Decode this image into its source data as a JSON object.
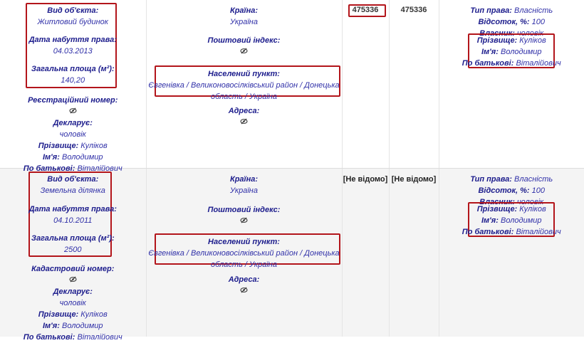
{
  "rows": [
    {
      "object": {
        "type_label": "Вид об'єкта:",
        "type_value": "Житловий будинок",
        "date_label": "Дата набуття права:",
        "date_value": "04.03.2013",
        "area_label": "Загальна площа (м²):",
        "area_value": "140,20",
        "id_label": "Реєстраційний номер:",
        "declarant_label": "Декларує:",
        "declarant_value": "чоловік",
        "surname_label": "Прізвище:",
        "surname_value": "Куліков",
        "name_label": "Ім'я:",
        "name_value": "Володимир",
        "patronymic_label": "По батькові:",
        "patronymic_value": "Віталійович"
      },
      "location": {
        "country_label": "Країна:",
        "country_value": "Україна",
        "postal_label": "Поштовий індекс:",
        "settlement_label": "Населений пункт:",
        "settlement_value_1": "Євгенівка / Великоновосілківський район / Донецька",
        "settlement_value_2": "область / Україна",
        "address_label": "Адреса:"
      },
      "cost": "475336",
      "cost2": "475336",
      "rights": {
        "type_label": "Тип права:",
        "type_value": "Власність",
        "share_label": "Відсоток, %:",
        "share_value": "100",
        "owner_label": "Власник:",
        "owner_value": "чоловік",
        "surname_label": "Прізвище:",
        "surname_value": "Куліков",
        "name_label": "Ім'я:",
        "name_value": "Володимир",
        "patronymic_label": "По батькові:",
        "patronymic_value": "Віталійович"
      }
    },
    {
      "object": {
        "type_label": "Вид об'єкта:",
        "type_value": "Земельна ділянка",
        "date_label": "Дата набуття права:",
        "date_value": "04.10.2011",
        "area_label": "Загальна площа (м²):",
        "area_value": "2500",
        "id_label": "Кадастровий номер:",
        "declarant_label": "Декларує:",
        "declarant_value": "чоловік",
        "surname_label": "Прізвище:",
        "surname_value": "Куліков",
        "name_label": "Ім'я:",
        "name_value": "Володимир",
        "patronymic_label": "По батькові:",
        "patronymic_value": "Віталійович"
      },
      "location": {
        "country_label": "Країна:",
        "country_value": "Україна",
        "postal_label": "Поштовий індекс:",
        "settlement_label": "Населений пункт:",
        "settlement_value_1": "Євгенівка / Великоновосілківський район / Донецька",
        "settlement_value_2": "область / Україна",
        "address_label": "Адреса:"
      },
      "cost": "[Не відомо]",
      "cost2": "[Не відомо]",
      "rights": {
        "type_label": "Тип права:",
        "type_value": "Власність",
        "share_label": "Відсоток, %:",
        "share_value": "100",
        "owner_label": "Власник:",
        "owner_value": "чоловік",
        "surname_label": "Прізвище:",
        "surname_value": "Куліков",
        "name_label": "Ім'я:",
        "name_value": "Володимир",
        "patronymic_label": "По батькові:",
        "patronymic_value": "Віталійович"
      }
    }
  ],
  "icons": {
    "hidden_value": "eye-slash-icon"
  },
  "colors": {
    "highlight_box": "#b3151b",
    "label_text": "#1c1c8c"
  }
}
